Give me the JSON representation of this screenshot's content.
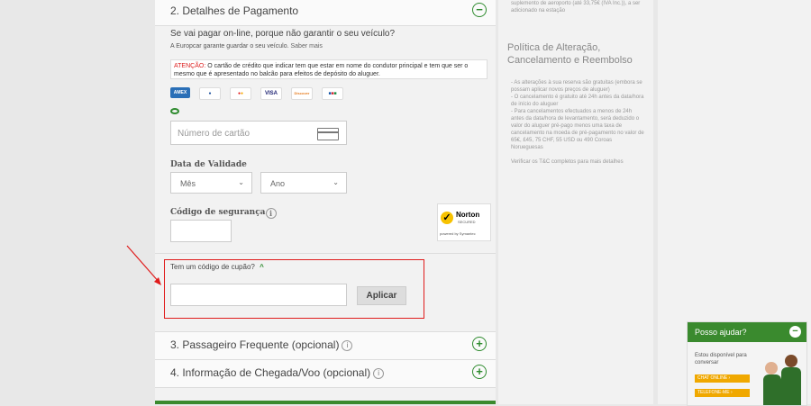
{
  "payment": {
    "title": "2. Detalhes de Pagamento",
    "question": "Se vai pagar on-line, porque não garantir o seu veículo?",
    "guarantee_text": "A Europcar garante guardar o seu veículo.",
    "more_link": "Saber mais",
    "warning_label": "ATENÇÃO:",
    "warning_text": "O cartão de crédito que indicar tem que estar em nome do condutor principal e tem que ser o mesmo que é apresentado no balcão para efeitos de depósito do aluguer.",
    "cards": [
      "AMEX",
      "Diners",
      "MasterCard",
      "VISA",
      "Discover",
      "JCB"
    ],
    "card_number_placeholder": "Número de cartão",
    "expiry_label": "Data de Validade",
    "month_value": "Mês",
    "year_value": "Ano",
    "security_label": "Código de segurança",
    "norton": {
      "brand": "Norton",
      "secured": "SECURED",
      "powered": "powered by Symantec"
    }
  },
  "coupon": {
    "toggle_label": "Tem um código de cupão?",
    "apply_label": "Aplicar"
  },
  "sections": {
    "frequent": "3. Passageiro Frequente (opcional)",
    "flight": "4. Informação de Chegada/Voo (opcional)"
  },
  "sidebar": {
    "top_text": "suplemento de aeroporto (até 33,75€ (IVA Inc.)), a ser adicionado na estação",
    "policy_title": "Política de Alteração, Cancelamento e Reembolso",
    "policy_lines": [
      "- As alterações à sua reserva são gratuitas (embora se possam aplicar novos preços de aluguer)",
      "- O cancelamento é gratuito até 24h antes da data/hora de início do aluguer",
      "- Para cancelamentos efectuados a menos de 24h antes da data/hora de levantamento, será deduzido o valor do aluguer pré-pago menos uma taxa de cancelamento na moeda de pré-pagamento no valor de 65€, £45, 75 CHF, 55 USD ou 490 Coroas Norueguesas"
    ],
    "policy_footer": "Verificar os T&C completos para mais detalhes"
  },
  "chat": {
    "title": "Posso ajudar?",
    "status": "Estou disponível para conversar",
    "online_btn": "CHAT ONLINE",
    "call_btn": "TELEFONE-ME"
  },
  "colors": {
    "accent": "#2e8b2e",
    "highlight": "#e01c1c"
  }
}
